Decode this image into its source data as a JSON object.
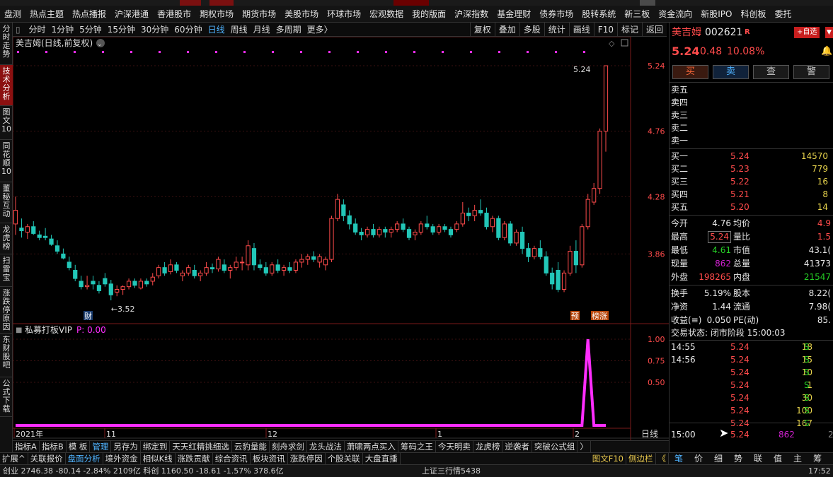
{
  "menu": [
    "盘测",
    "热点主题",
    "热点播报",
    "沪深港通",
    "香港股市",
    "期权市场",
    "期货市场",
    "美股市场",
    "环球市场",
    "宏观数据",
    "我的版面",
    "沪深指数",
    "基金理财",
    "债券市场",
    "股转系统",
    "新三板",
    "资金流向",
    "新股IPO",
    "科创板",
    "委托"
  ],
  "left_tabs": [
    "分时走势",
    "技术分析",
    "图文10",
    "同花顺10",
    "董秘互动",
    "龙虎榜",
    "扫雷宝",
    "涨跌停原因",
    "东财股吧",
    "公式下载"
  ],
  "periods": [
    "分时",
    "1分钟",
    "5分钟",
    "15分钟",
    "30分钟",
    "60分钟",
    "日线",
    "周线",
    "月线",
    "多周期",
    "更多〉"
  ],
  "period_active": "日线",
  "period_right": [
    "复权",
    "叠加",
    "多股",
    "统计",
    "画线",
    "F10",
    "标记",
    "返回"
  ],
  "chart": {
    "title": "美吉姆(日线,前复权)",
    "price_ticks": [
      "5.24",
      "4.76",
      "4.28",
      "3.86"
    ],
    "high_label": "5.24",
    "low_label": "←3.52",
    "marker_cai": "财",
    "marker_yu": "预",
    "marker_zt": "榜涨",
    "indicator_title": "私募打板VIP",
    "indicator_value": "P: 0.00",
    "indicator_ticks": [
      "1.00",
      "0.75",
      "0.50"
    ],
    "date_labels": [
      "2021年",
      "11",
      "12",
      "1",
      "2"
    ],
    "period_label": "日线",
    "zoom_plus": "+",
    "zoom_minus": "−",
    "up_color": "#ff4b4b",
    "down_color": "#22c7b8",
    "indicator_color": "#ff2dff"
  },
  "chart_data": {
    "type": "candlestick",
    "title": "美吉姆(日线,前复权)",
    "ylim": [
      3.38,
      5.38
    ],
    "candles": [
      [
        4.08,
        4.28,
        4.0,
        4.18
      ],
      [
        4.05,
        4.12,
        3.98,
        4.03
      ],
      [
        4.02,
        4.08,
        3.97,
        4.06
      ],
      [
        4.06,
        4.1,
        4.0,
        4.01
      ],
      [
        4.0,
        4.03,
        3.96,
        3.98
      ],
      [
        3.99,
        4.05,
        3.96,
        3.98
      ],
      [
        3.97,
        4.0,
        3.92,
        3.93
      ],
      [
        3.92,
        3.96,
        3.86,
        3.88
      ],
      [
        3.86,
        3.9,
        3.82,
        3.83
      ],
      [
        3.8,
        3.84,
        3.74,
        3.76
      ],
      [
        3.74,
        3.78,
        3.66,
        3.68
      ],
      [
        3.66,
        3.7,
        3.6,
        3.62
      ],
      [
        3.62,
        3.7,
        3.6,
        3.63
      ],
      [
        3.66,
        3.7,
        3.6,
        3.64
      ],
      [
        3.63,
        3.66,
        3.57,
        3.59
      ],
      [
        3.68,
        3.72,
        3.62,
        3.64
      ],
      [
        3.64,
        3.67,
        3.52,
        3.56
      ],
      [
        3.58,
        3.63,
        3.55,
        3.6
      ],
      [
        3.6,
        3.63,
        3.56,
        3.62
      ],
      [
        3.62,
        3.68,
        3.6,
        3.66
      ],
      [
        3.66,
        3.68,
        3.61,
        3.63
      ],
      [
        3.61,
        3.68,
        3.6,
        3.66
      ],
      [
        3.66,
        3.68,
        3.62,
        3.64
      ],
      [
        3.66,
        3.72,
        3.63,
        3.69
      ],
      [
        3.7,
        3.78,
        3.68,
        3.76
      ],
      [
        3.76,
        3.8,
        3.7,
        3.72
      ],
      [
        3.73,
        3.82,
        3.71,
        3.78
      ],
      [
        3.78,
        3.8,
        3.72,
        3.74
      ],
      [
        3.7,
        3.74,
        3.66,
        3.72
      ],
      [
        3.72,
        3.78,
        3.7,
        3.76
      ],
      [
        3.74,
        3.78,
        3.68,
        3.7
      ],
      [
        3.7,
        3.74,
        3.66,
        3.72
      ],
      [
        3.72,
        3.8,
        3.7,
        3.76
      ],
      [
        3.76,
        3.79,
        3.72,
        3.75
      ],
      [
        3.75,
        3.84,
        3.73,
        3.82
      ],
      [
        3.78,
        3.82,
        3.72,
        3.74
      ],
      [
        3.74,
        3.78,
        3.68,
        3.76
      ],
      [
        3.76,
        3.84,
        3.74,
        3.8
      ],
      [
        3.8,
        3.84,
        3.74,
        3.8
      ],
      [
        3.78,
        3.96,
        3.74,
        3.92
      ],
      [
        3.9,
        3.94,
        3.74,
        3.78
      ],
      [
        3.78,
        3.82,
        3.74,
        3.76
      ],
      [
        3.76,
        3.8,
        3.7,
        3.72
      ],
      [
        3.72,
        3.8,
        3.7,
        3.78
      ],
      [
        3.78,
        3.82,
        3.72,
        3.74
      ],
      [
        3.74,
        3.78,
        3.7,
        3.76
      ],
      [
        3.76,
        3.8,
        3.72,
        3.74
      ],
      [
        3.74,
        3.82,
        3.72,
        3.8
      ],
      [
        3.8,
        3.86,
        3.76,
        3.82
      ],
      [
        3.82,
        3.86,
        3.78,
        3.84
      ],
      [
        3.84,
        3.88,
        3.8,
        3.82
      ],
      [
        3.8,
        3.86,
        3.76,
        3.84
      ],
      [
        3.78,
        3.84,
        3.74,
        3.82
      ],
      [
        3.82,
        4.14,
        3.8,
        4.12
      ],
      [
        4.12,
        4.3,
        4.1,
        4.26
      ],
      [
        4.22,
        4.26,
        4.1,
        4.14
      ],
      [
        4.14,
        4.18,
        4.04,
        4.08
      ],
      [
        4.08,
        4.12,
        4.0,
        4.02
      ],
      [
        4.02,
        4.05,
        3.96,
        4.0
      ],
      [
        4.0,
        4.06,
        3.98,
        4.04
      ],
      [
        4.04,
        4.08,
        3.98,
        4.0
      ],
      [
        4.0,
        4.06,
        3.98,
        4.04
      ],
      [
        4.04,
        4.06,
        3.98,
        4.02
      ],
      [
        4.02,
        4.06,
        3.98,
        4.04
      ],
      [
        4.04,
        4.1,
        4.02,
        4.08
      ],
      [
        4.08,
        4.12,
        4.02,
        4.04
      ],
      [
        4.04,
        4.06,
        3.96,
        3.98
      ],
      [
        4.0,
        4.04,
        3.96,
        4.02
      ],
      [
        4.02,
        4.1,
        4.0,
        4.08
      ],
      [
        4.08,
        4.14,
        4.04,
        4.06
      ],
      [
        4.06,
        4.08,
        4.0,
        4.02
      ],
      [
        4.02,
        4.08,
        4.0,
        4.06
      ],
      [
        4.06,
        4.08,
        4.02,
        4.04
      ],
      [
        4.04,
        4.06,
        3.98,
        4.0
      ],
      [
        4.04,
        4.1,
        4.02,
        4.08
      ],
      [
        4.08,
        4.24,
        4.06,
        4.16
      ],
      [
        4.16,
        4.2,
        4.1,
        4.14
      ],
      [
        4.14,
        4.22,
        4.1,
        4.18
      ],
      [
        4.18,
        4.26,
        4.14,
        4.16
      ],
      [
        4.16,
        4.2,
        4.04,
        4.06
      ],
      [
        4.06,
        4.14,
        4.02,
        4.12
      ],
      [
        4.12,
        4.14,
        3.96,
        3.98
      ],
      [
        3.98,
        4.1,
        3.96,
        4.08
      ],
      [
        4.08,
        4.1,
        3.92,
        3.94
      ],
      [
        3.94,
        4.04,
        3.92,
        4.02
      ],
      [
        4.02,
        4.06,
        3.86,
        3.9
      ],
      [
        3.9,
        3.94,
        3.8,
        3.84
      ],
      [
        3.84,
        3.92,
        3.82,
        3.9
      ],
      [
        3.9,
        3.96,
        3.82,
        3.84
      ],
      [
        3.84,
        3.88,
        3.7,
        3.72
      ],
      [
        3.72,
        3.76,
        3.6,
        3.64
      ],
      [
        3.74,
        3.8,
        3.58,
        3.6
      ],
      [
        3.6,
        3.74,
        3.58,
        3.72
      ],
      [
        3.72,
        3.92,
        3.7,
        3.88
      ],
      [
        3.88,
        3.96,
        3.72,
        3.78
      ],
      [
        3.78,
        4.08,
        3.76,
        4.06
      ],
      [
        4.06,
        4.3,
        4.04,
        4.26
      ],
      [
        4.24,
        4.38,
        4.22,
        4.34
      ],
      [
        4.34,
        4.78,
        4.3,
        4.76
      ],
      [
        4.76,
        5.24,
        4.61,
        5.24
      ]
    ],
    "indicator": [
      0,
      0,
      0,
      0,
      0,
      0,
      0,
      0,
      0,
      0,
      0,
      0,
      0,
      0,
      0,
      0,
      0,
      0,
      0,
      0,
      0,
      0,
      0,
      0,
      0,
      0,
      0,
      0,
      0,
      0,
      0,
      0,
      0,
      0,
      0,
      0,
      0,
      0,
      0,
      0,
      0,
      0,
      0,
      0,
      0,
      0,
      0,
      0,
      0,
      0,
      0,
      0,
      0,
      0,
      0,
      0,
      0,
      0,
      0,
      0,
      0,
      0,
      0,
      0,
      0,
      0,
      0,
      0,
      0,
      0,
      0,
      0,
      0,
      0,
      0,
      0,
      0,
      0,
      0,
      0,
      0,
      0,
      0,
      0,
      0,
      0,
      0,
      0,
      0,
      0,
      0,
      0,
      0,
      0,
      0,
      0,
      1.0,
      0,
      0,
      0
    ],
    "indicator_ylim": [
      0,
      1.0
    ]
  },
  "quote": {
    "name": "美吉姆",
    "code": "002621",
    "r_mark": "R",
    "add_label": "+自选",
    "price": "5.24",
    "change": "0.48",
    "pct": "10.08%",
    "buttons": [
      "买",
      "卖",
      "查",
      "警"
    ],
    "asks": [
      {
        "label": "卖五",
        "price": "",
        "vol": ""
      },
      {
        "label": "卖四",
        "price": "",
        "vol": ""
      },
      {
        "label": "卖三",
        "price": "",
        "vol": ""
      },
      {
        "label": "卖二",
        "price": "",
        "vol": ""
      },
      {
        "label": "卖一",
        "price": "",
        "vol": ""
      }
    ],
    "bids": [
      {
        "label": "买一",
        "price": "5.24",
        "vol": "14570"
      },
      {
        "label": "买二",
        "price": "5.23",
        "vol": "779"
      },
      {
        "label": "买三",
        "price": "5.22",
        "vol": "16"
      },
      {
        "label": "买四",
        "price": "5.21",
        "vol": "8"
      },
      {
        "label": "买五",
        "price": "5.20",
        "vol": "14"
      }
    ],
    "stats": [
      {
        "l1": "今开",
        "v1": "4.76",
        "c1": "white",
        "l2": "均价",
        "v2": "4.9",
        "c2": "red"
      },
      {
        "l1": "最高",
        "v1": "5.24",
        "c1": "red",
        "l2": "量比",
        "v2": "1.5",
        "c2": "red"
      },
      {
        "l1": "最低",
        "v1": "4.61",
        "c1": "green",
        "l2": "市值",
        "v2": "43.1(",
        "c2": "white"
      },
      {
        "l1": "现量",
        "v1": "862",
        "c1": "purple",
        "l2": "总量",
        "v2": "41373",
        "c2": "white"
      },
      {
        "l1": "外盘",
        "v1": "198265",
        "c1": "red",
        "l2": "内盘",
        "v2": "21547",
        "c2": "green"
      }
    ],
    "stats2": [
      {
        "l1": "换手",
        "v1": "5.19%",
        "l2": "股本",
        "v2": "8.22("
      },
      {
        "l1": "净资",
        "v1": "1.44",
        "l2": "流通",
        "v2": "7.98("
      },
      {
        "l1": "收益(≡)",
        "v1": "0.050",
        "l2": "PE(动)",
        "v2": "85."
      }
    ],
    "trade_status": "交易状态: 闭市阶段 15:00:03",
    "ticks": [
      {
        "time": "14:55",
        "price": "5.24",
        "vol": "18",
        "side": "S"
      },
      {
        "time": "14:56",
        "price": "5.24",
        "vol": "15",
        "side": "S"
      },
      {
        "time": "",
        "price": "5.24",
        "vol": "10",
        "side": "S"
      },
      {
        "time": "",
        "price": "5.24",
        "vol": "1",
        "side": "S"
      },
      {
        "time": "",
        "price": "5.24",
        "vol": "30",
        "side": "S"
      },
      {
        "time": "",
        "price": "5.24",
        "vol": "100",
        "side": "S"
      },
      {
        "time": "",
        "price": "5.24",
        "vol": "167",
        "side": "S"
      }
    ],
    "last_tick": {
      "time": "15:00",
      "price": "5.24",
      "vol": "862",
      "extra": "2"
    }
  },
  "bottom1": [
    "指标A",
    "指标B",
    "模 板",
    "管理",
    "另存为",
    "绑定到",
    "天天红精挑细选",
    "云豹量能",
    "刻舟求剑",
    "龙头战法",
    "萧啸两点买入",
    "筹码之王",
    "今天明卖",
    "龙虎榜",
    "逆袭者",
    "突破公式组",
    "〉"
  ],
  "bottom1_active": "管理",
  "bottom2": [
    "扩展^",
    "关联报价",
    "盘面分析",
    "境外资金",
    "相似K线",
    "涨跌贡献",
    "综合资讯",
    "板块资讯",
    "涨跌停因",
    "个股关联",
    "大盘直播"
  ],
  "bottom2_active": "盘面分析",
  "bottom2_right": [
    "图文F10",
    "侧边栏",
    "《"
  ],
  "right_tabs": [
    "笔",
    "价",
    "细",
    "势",
    "联",
    "值",
    "主",
    "筹"
  ],
  "status": {
    "left": "创业 2746.38  -80.14  -2.84%  2109亿  科创 1160.50  -18.61  -1.57%  378.6亿",
    "mid": "上证三行情5438",
    "time": "17:52"
  }
}
